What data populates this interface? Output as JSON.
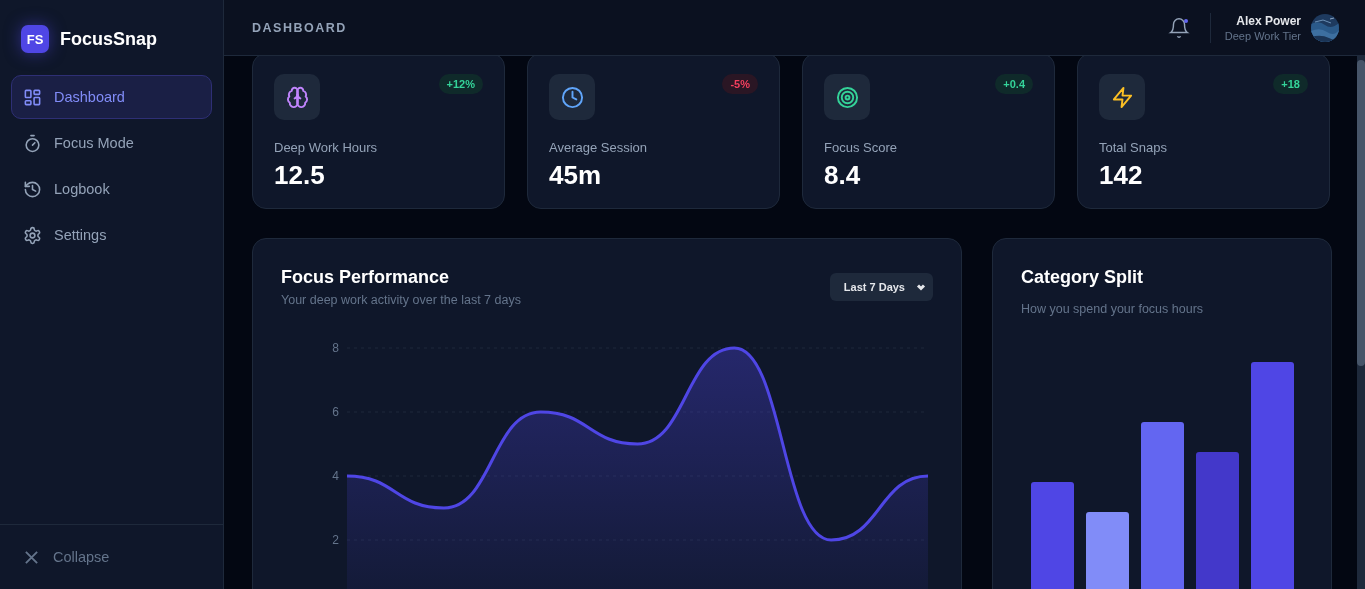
{
  "sidebar": {
    "logo": {
      "badge": "FS",
      "name": "FocusSnap"
    },
    "nav": [
      {
        "label": "Dashboard",
        "kind": "grid",
        "selected": true
      },
      {
        "label": "Focus Mode",
        "kind": "timer",
        "selected": false
      },
      {
        "label": "Logbook",
        "kind": "history",
        "selected": false
      },
      {
        "label": "Settings",
        "kind": "gear",
        "selected": false
      }
    ],
    "collapse": {
      "label": "Collapse"
    }
  },
  "header": {
    "title": "DASHBOARD",
    "notifications": {
      "unread": true
    },
    "user": {
      "name": "Alex Power",
      "tier": "Deep Work Tier"
    }
  },
  "stats": [
    {
      "kind": "brain",
      "label": "Deep Work Hours",
      "value": "12.5",
      "change": "+12%",
      "positive": true
    },
    {
      "kind": "clock",
      "label": "Average Session",
      "value": "45m",
      "change": "-5%",
      "positive": false
    },
    {
      "kind": "target",
      "label": "Focus Score",
      "value": "8.4",
      "change": "+0.4",
      "positive": true
    },
    {
      "kind": "bolt",
      "label": "Total Snaps",
      "value": "142",
      "change": "+18",
      "positive": true
    }
  ],
  "performance": {
    "title": "Focus Performance",
    "subtitle": "Your deep work activity over the last 7 days",
    "range": "Last 7 Days",
    "chart_data": {
      "type": "area",
      "values": [
        4,
        3,
        6,
        5,
        8,
        2,
        4
      ],
      "grid": true,
      "ylim": [
        0,
        8
      ],
      "yticks": [
        2,
        4,
        6,
        8
      ]
    }
  },
  "category": {
    "title": "Category Split",
    "subtitle": "How you spend your focus hours"
  }
}
